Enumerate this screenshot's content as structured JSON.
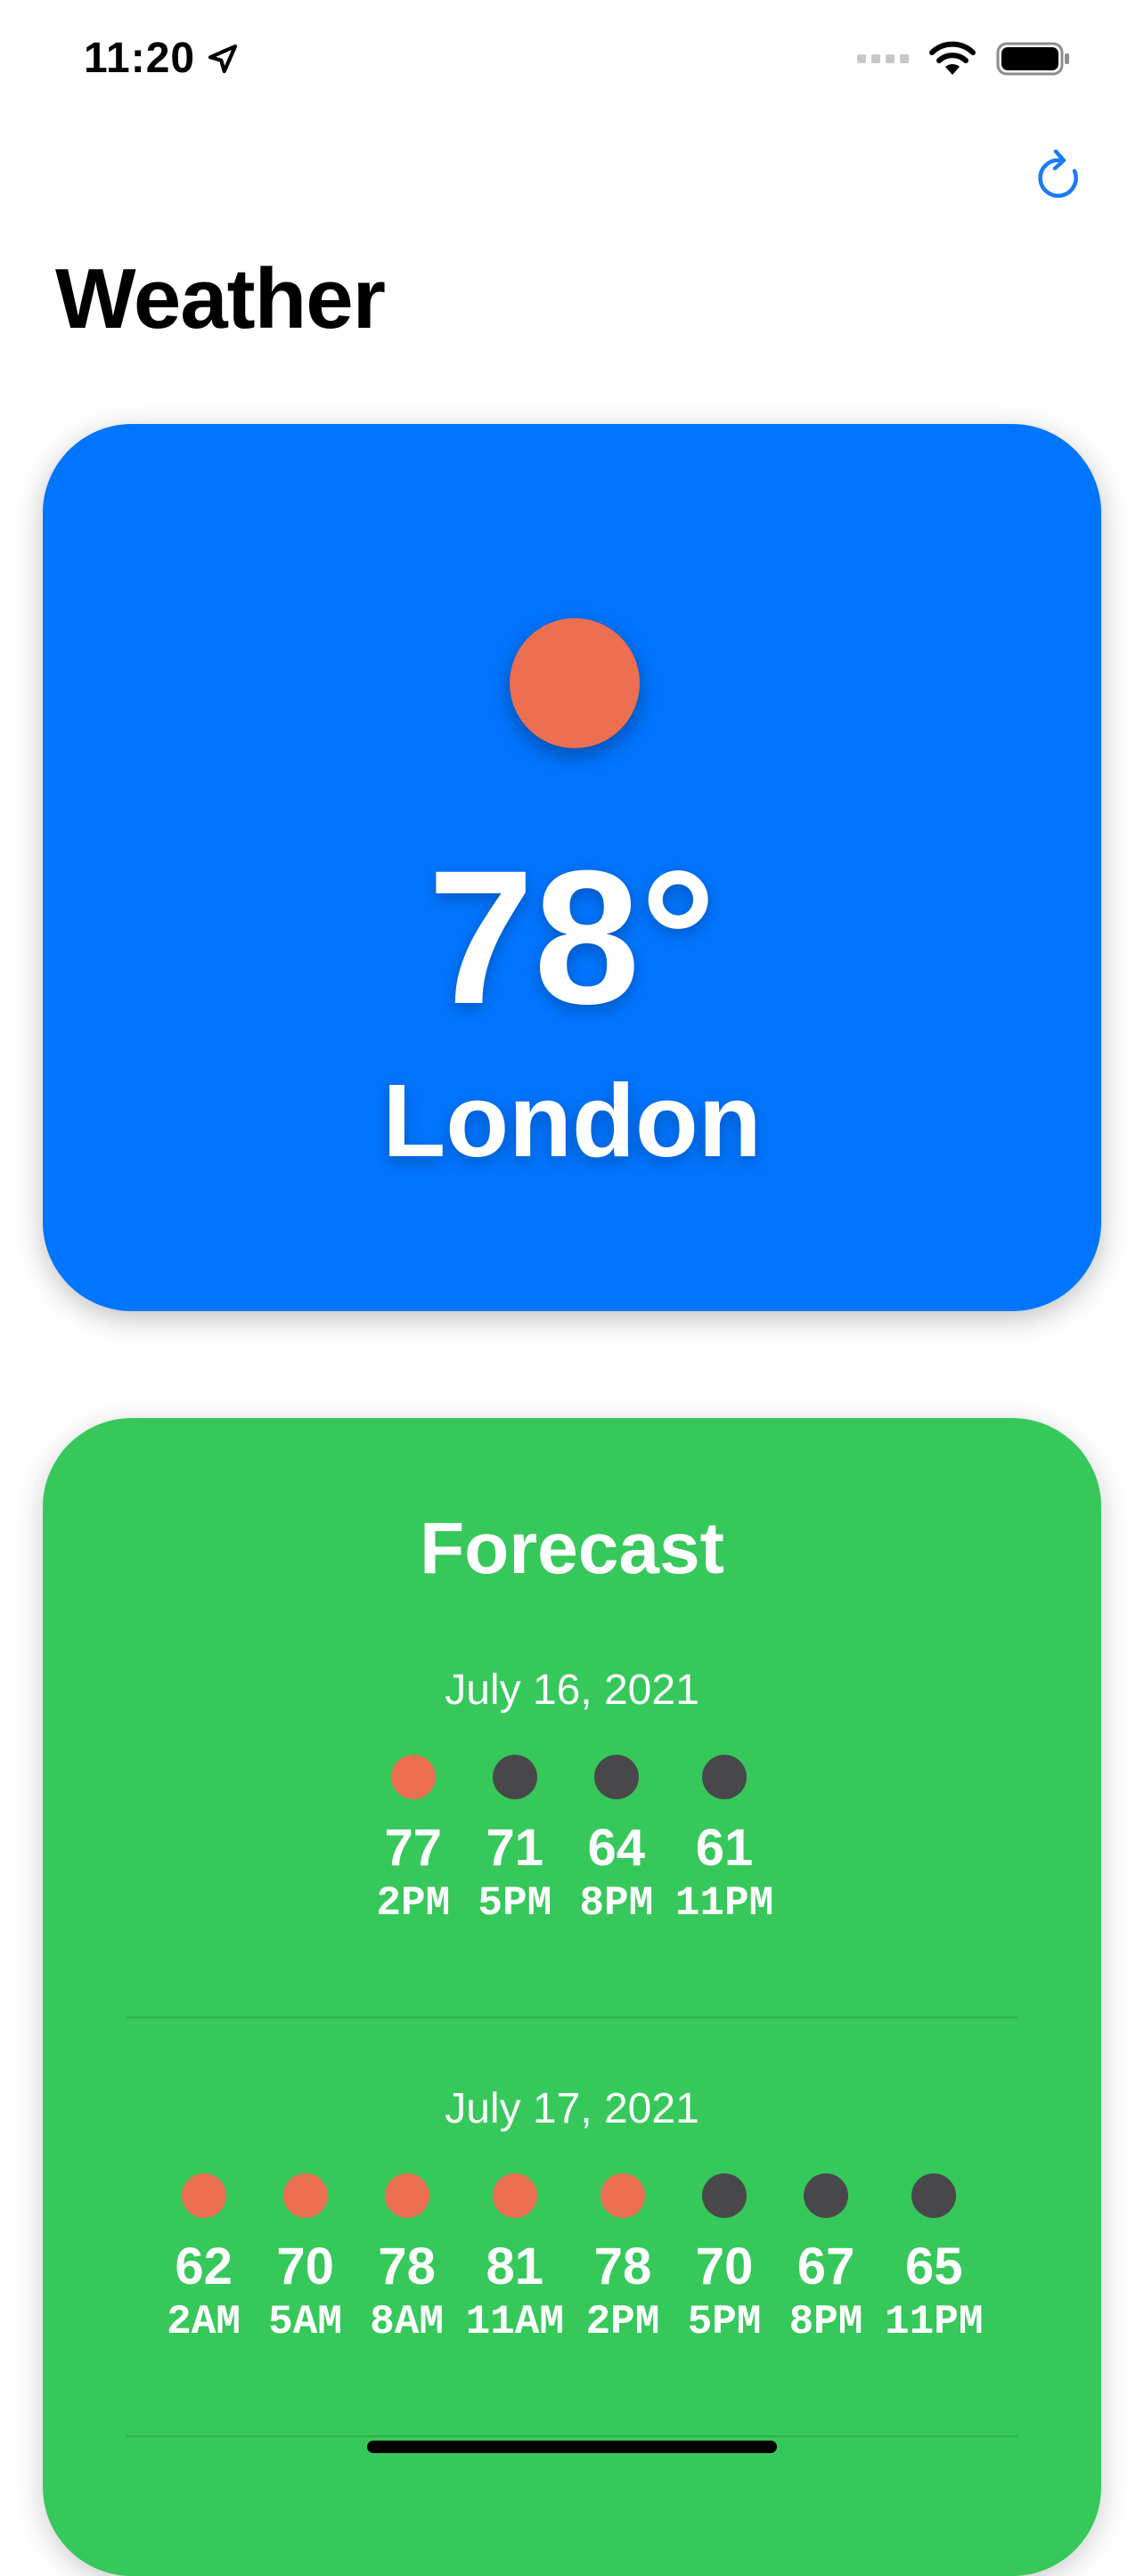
{
  "status_bar": {
    "time": "11:20"
  },
  "nav": {
    "title": "Weather",
    "refresh_icon": "refresh-icon"
  },
  "current": {
    "temperature": "78°",
    "city": "London",
    "condition_icon": "sun-icon",
    "card_color": "#0075ff",
    "sun_color": "#eb6f50"
  },
  "forecast": {
    "title": "Forecast",
    "card_color": "#36c85a",
    "days": [
      {
        "date": "July 16, 2021",
        "hours": [
          {
            "temp": "77",
            "time": "2PM",
            "icon": "sun-icon",
            "color": "#eb6f50"
          },
          {
            "temp": "71",
            "time": "5PM",
            "icon": "moon-icon",
            "color": "#48484a"
          },
          {
            "temp": "64",
            "time": "8PM",
            "icon": "moon-icon",
            "color": "#48484a"
          },
          {
            "temp": "61",
            "time": "11PM",
            "icon": "moon-icon",
            "color": "#48484a"
          }
        ]
      },
      {
        "date": "July 17, 2021",
        "hours": [
          {
            "temp": "62",
            "time": "2AM",
            "icon": "sun-icon",
            "color": "#eb6f50"
          },
          {
            "temp": "70",
            "time": "5AM",
            "icon": "sun-icon",
            "color": "#eb6f50"
          },
          {
            "temp": "78",
            "time": "8AM",
            "icon": "sun-icon",
            "color": "#eb6f50"
          },
          {
            "temp": "81",
            "time": "11AM",
            "icon": "sun-icon",
            "color": "#eb6f50"
          },
          {
            "temp": "78",
            "time": "2PM",
            "icon": "sun-icon",
            "color": "#eb6f50"
          },
          {
            "temp": "70",
            "time": "5PM",
            "icon": "moon-icon",
            "color": "#48484a"
          },
          {
            "temp": "67",
            "time": "8PM",
            "icon": "moon-icon",
            "color": "#48484a"
          },
          {
            "temp": "65",
            "time": "11PM",
            "icon": "moon-icon",
            "color": "#48484a"
          }
        ]
      }
    ]
  }
}
